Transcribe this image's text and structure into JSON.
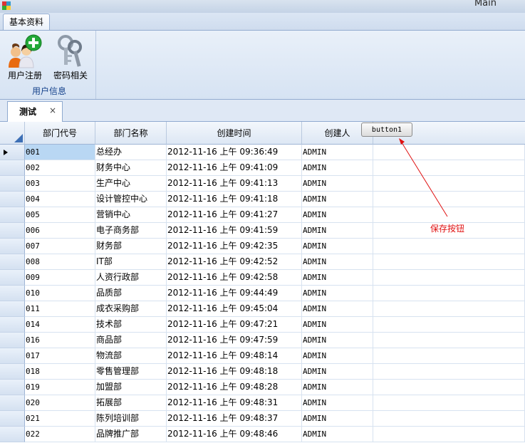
{
  "window": {
    "title": "Main"
  },
  "ribbon": {
    "tab_label": "基本资料",
    "buttons": [
      {
        "label": "用户注册",
        "icon": "users-add-icon"
      },
      {
        "label": "密码相关",
        "icon": "keys-icon"
      }
    ],
    "group_label": "用户信息"
  },
  "doc_tab": {
    "label": "测试",
    "close": "×"
  },
  "grid": {
    "columns": [
      "部门代号",
      "部门名称",
      "创建时间",
      "创建人"
    ],
    "rows": [
      [
        "001",
        "总经办",
        "2012-11-16 上午 09:36:49",
        "ADMIN"
      ],
      [
        "002",
        "财务中心",
        "2012-11-16 上午 09:41:09",
        "ADMIN"
      ],
      [
        "003",
        "生产中心",
        "2012-11-16 上午 09:41:13",
        "ADMIN"
      ],
      [
        "004",
        "设计管控中心",
        "2012-11-16 上午 09:41:18",
        "ADMIN"
      ],
      [
        "005",
        "营销中心",
        "2012-11-16 上午 09:41:27",
        "ADMIN"
      ],
      [
        "006",
        "电子商务部",
        "2012-11-16 上午 09:41:59",
        "ADMIN"
      ],
      [
        "007",
        "财务部",
        "2012-11-16 上午 09:42:35",
        "ADMIN"
      ],
      [
        "008",
        "IT部",
        "2012-11-16 上午 09:42:52",
        "ADMIN"
      ],
      [
        "009",
        "人资行政部",
        "2012-11-16 上午 09:42:58",
        "ADMIN"
      ],
      [
        "010",
        "品质部",
        "2012-11-16 上午 09:44:49",
        "ADMIN"
      ],
      [
        "011",
        "成衣采购部",
        "2012-11-16 上午 09:45:04",
        "ADMIN"
      ],
      [
        "014",
        "技术部",
        "2012-11-16 上午 09:47:21",
        "ADMIN"
      ],
      [
        "016",
        "商品部",
        "2012-11-16 上午 09:47:59",
        "ADMIN"
      ],
      [
        "017",
        "物流部",
        "2012-11-16 上午 09:48:14",
        "ADMIN"
      ],
      [
        "018",
        "零售管理部",
        "2012-11-16 上午 09:48:18",
        "ADMIN"
      ],
      [
        "019",
        "加盟部",
        "2012-11-16 上午 09:48:28",
        "ADMIN"
      ],
      [
        "020",
        "拓展部",
        "2012-11-16 上午 09:48:31",
        "ADMIN"
      ],
      [
        "021",
        "陈列培训部",
        "2012-11-16 上午 09:48:37",
        "ADMIN"
      ],
      [
        "022",
        "品牌推广部",
        "2012-11-16 上午 09:48:46",
        "ADMIN"
      ]
    ]
  },
  "button1": {
    "label": "button1"
  },
  "annotation": {
    "text": "保存按钮",
    "color": "#e01010"
  }
}
